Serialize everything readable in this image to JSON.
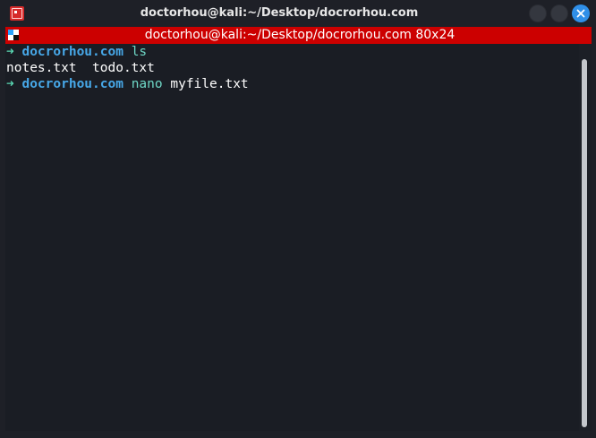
{
  "window": {
    "title": "doctorhou@kali:~/Desktop/docrorhou.com"
  },
  "tab": {
    "title": "doctorhou@kali:~/Desktop/docrorhou.com 80x24"
  },
  "terminal": {
    "lines": [
      {
        "arrow": "➜",
        "dir": "docrorhou.com",
        "cmd": "ls",
        "args": ""
      },
      {
        "output": "notes.txt  todo.txt"
      },
      {
        "arrow": "➜",
        "dir": "docrorhou.com",
        "cmd": "nano",
        "args": "myfile.txt"
      }
    ]
  },
  "colors": {
    "tabbar": "#cc0000",
    "prompt_arrow": "#59d6b2",
    "prompt_dir": "#47a8e8",
    "command": "#6fd8c7",
    "close_button": "#2f8fe8",
    "background": "#1a1d24"
  },
  "icons": {
    "app": "terminal-app-icon",
    "tab": "session-icon",
    "minimize": "minimize-icon",
    "maximize": "maximize-icon",
    "close": "close-icon"
  }
}
